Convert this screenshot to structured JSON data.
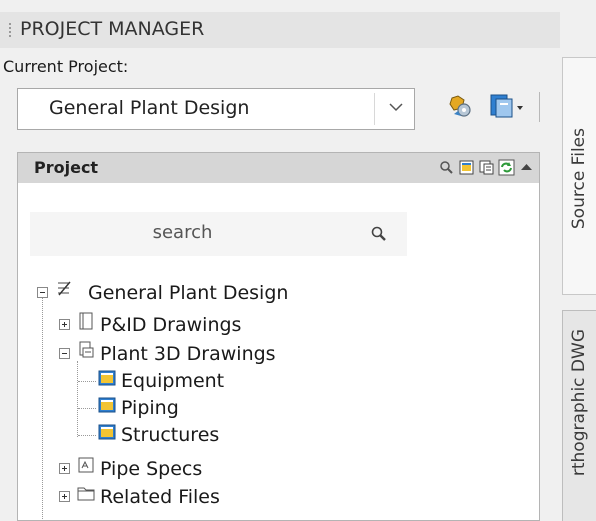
{
  "header": {
    "title": "PROJECT MANAGER"
  },
  "current_project": {
    "label": "Current Project:",
    "value": "General Plant Design"
  },
  "panel": {
    "title": "Project",
    "search_placeholder": "search"
  },
  "tree": {
    "root": "General Plant Design",
    "pid": "P&ID Drawings",
    "plant3d": "Plant 3D Drawings",
    "equipment": "Equipment",
    "piping": "Piping",
    "structures": "Structures",
    "pipe_specs": "Pipe Specs",
    "related_files": "Related Files"
  },
  "side_tabs": {
    "source_files": "Source Files",
    "orthographic": "rthographic DWG"
  },
  "icons": {
    "grip": "grip-icon",
    "dropdown": "chevron-down-icon",
    "project_settings": "project-settings-icon",
    "publish": "publish-icon",
    "search": "search-icon",
    "new_drawing": "new-drawing-icon",
    "copy": "copy-drawing-icon",
    "refresh": "refresh-icon",
    "collapse": "caret-up-icon"
  },
  "colors": {
    "panel_header": "#d6d6d6",
    "accent_blue": "#2f7fd0",
    "accent_yellow": "#f2c433",
    "refresh_green": "#2e9a3a"
  }
}
